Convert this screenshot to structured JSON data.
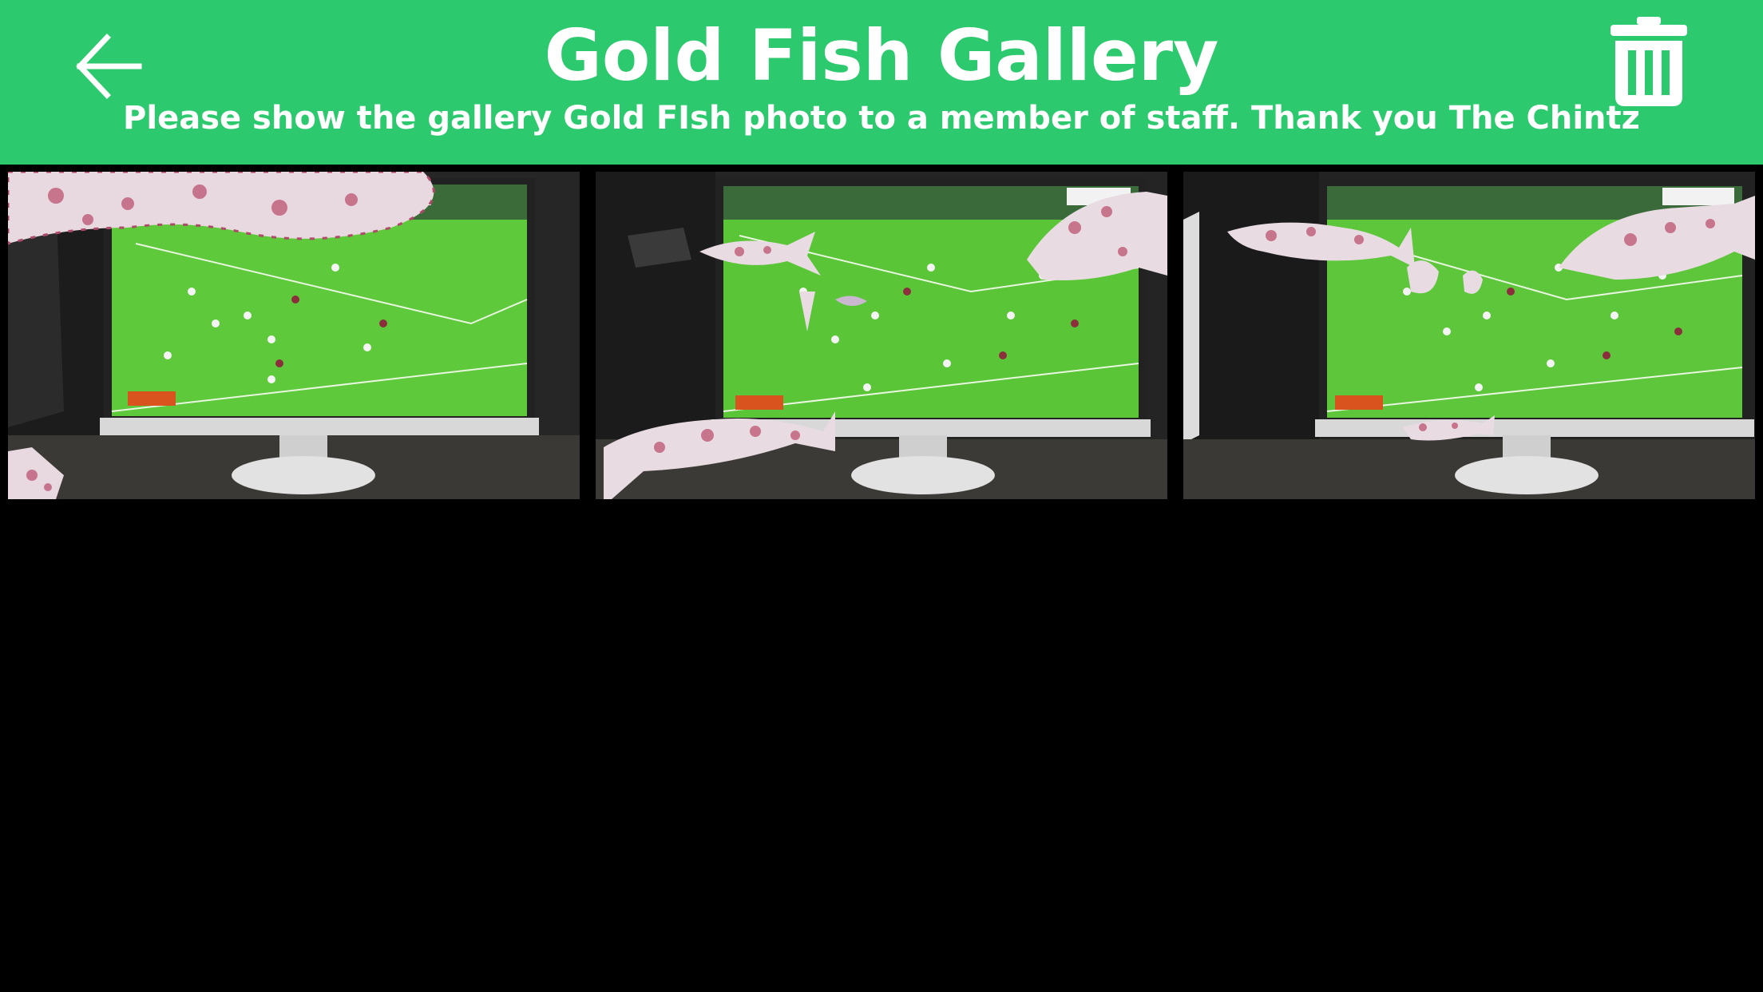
{
  "header": {
    "title": "Gold Fish Gallery",
    "subtitle": "Please show the gallery Gold FIsh photo to a member of staff. Thank you The Chintz",
    "back_icon": "arrow-left-icon",
    "delete_icon": "trash-icon"
  },
  "colors": {
    "accent": "#2cc96e",
    "background": "#000000",
    "text": "#ffffff"
  },
  "gallery": {
    "photos": [
      {
        "description": "photo-1"
      },
      {
        "description": "photo-2"
      },
      {
        "description": "photo-3"
      }
    ]
  }
}
